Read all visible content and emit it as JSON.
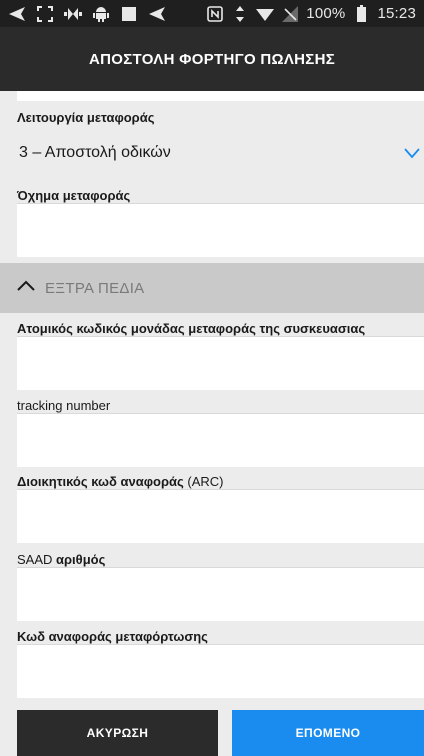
{
  "status_bar": {
    "left_icons": [
      "back-arrow-icon",
      "screenshot-icon",
      "media-icon",
      "android-icon",
      "square-icon",
      "send-icon"
    ],
    "right_icons": [
      "nfc-icon",
      "data-arrows-icon",
      "wifi-icon",
      "no-signal-icon"
    ],
    "battery_percent": "100%",
    "time": "15:23"
  },
  "header": {
    "title": "ΑΠΟΣΤΟΛΗ ΦΟΡΤΗΓΟ ΠΩΛΗΣΗΣ"
  },
  "form": {
    "transport_function": {
      "label": "Λειτουργία μεταφοράς",
      "value": "3 – Αποστολή οδικών"
    },
    "transport_vehicle": {
      "label": "Όχημα μεταφοράς",
      "value": ""
    }
  },
  "extra_section": {
    "title": "ΕΞΤΡΑ ΠΕΔΙΑ",
    "icon": "chevron-up-icon"
  },
  "extra_fields": {
    "atomic_code": {
      "label": "Ατομικός κωδικός μονάδας μεταφοράς της συσκευασιας",
      "value": ""
    },
    "tracking": {
      "label": "tracking number",
      "value": ""
    },
    "arc": {
      "label_bold": "Διοικητικός κωδ αναφοράς",
      "label_rest": " (ARC)",
      "value": ""
    },
    "saad": {
      "label_prefix": "SAAD ",
      "label_bold": "αριθμός",
      "value": ""
    },
    "transshipment": {
      "label": "Κωδ αναφοράς μεταφόρτωσης",
      "value": ""
    }
  },
  "footer": {
    "cancel_label": "ΑΚΥΡΩΣΗ",
    "next_label": "ΕΠΟΜΕΝΟ"
  },
  "colors": {
    "accent": "#1a8cf0",
    "appbar": "#2b2b2b",
    "section_bg": "#c9c9c9"
  }
}
